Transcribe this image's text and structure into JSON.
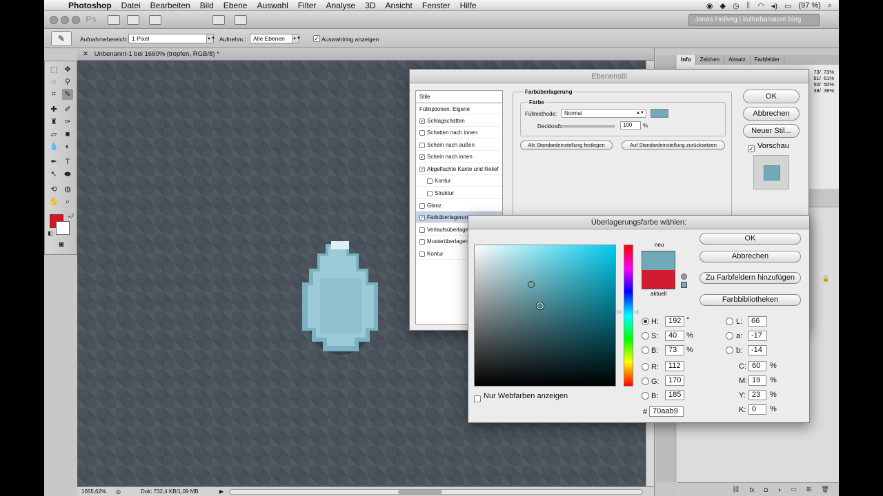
{
  "menubar": {
    "items": [
      "Photoshop",
      "Datei",
      "Bearbeiten",
      "Bild",
      "Ebene",
      "Auswahl",
      "Filter",
      "Analyse",
      "3D",
      "Ansicht",
      "Fenster",
      "Hilfe"
    ],
    "battery": "(97 %)"
  },
  "appbar": {
    "ps_badge": "Ps",
    "workspace_label": "Jonas Hellwig | kulturbanause blog"
  },
  "options": {
    "sample_size_label": "Aufnahmebereich:",
    "sample_size_value": "1 Pixel",
    "sample_label": "Aufnehm.:",
    "sample_value": "Alle Ebenen",
    "ring_label": "Auswahlring anzeigen"
  },
  "document": {
    "tab_title": "Unbenannt-1 bei 1660% (tropfen, RGB/8) *",
    "zoom": "1655,62%",
    "doc_info": "Dok: 732,4 KB/1,09 MB"
  },
  "right_panel": {
    "tabs": [
      "Info",
      "Zeichen",
      "Absatz",
      "Farbfelder"
    ],
    "info_values": "73/  73%\n61/  61%\n50/  50%\n38/  38%"
  },
  "ebenenstil": {
    "title": "Ebenenstil",
    "list": [
      {
        "label": "Stile",
        "checkbox": false
      },
      {
        "label": "Fülloptionen: Eigene",
        "checkbox": false
      },
      {
        "label": "Schlagschatten",
        "checkbox": true,
        "checked": true
      },
      {
        "label": "Schatten nach innen",
        "checkbox": true,
        "checked": false
      },
      {
        "label": "Schein nach außen",
        "checkbox": true,
        "checked": false
      },
      {
        "label": "Schein nach innen",
        "checkbox": true,
        "checked": true
      },
      {
        "label": "Abgeflachte Kante und Relief",
        "checkbox": true,
        "checked": true
      },
      {
        "label": "Kontur",
        "checkbox": true,
        "checked": false
      },
      {
        "label": "Struktur",
        "checkbox": true,
        "checked": false
      },
      {
        "label": "Glanz",
        "checkbox": true,
        "checked": false
      },
      {
        "label": "Farbüberlagerung",
        "checkbox": true,
        "checked": true
      },
      {
        "label": "Verlaufsüberlagerung",
        "checkbox": true,
        "checked": false
      },
      {
        "label": "Musterüberlagerung",
        "checkbox": true,
        "checked": false
      },
      {
        "label": "Kontur",
        "checkbox": true,
        "checked": false
      }
    ],
    "group_title": "Farbüberlagerung",
    "sub_title": "Farbe",
    "blend_label": "Füllmethode:",
    "blend_value": "Normal",
    "opacity_label": "Deckkraft:",
    "opacity_value": "100",
    "opacity_unit": "%",
    "overlay_color": "#70aab9",
    "btn_set_default": "Als Standardeinstellung festlegen",
    "btn_reset_default": "Auf Standardeinstellung zurücksetzen",
    "ok": "OK",
    "cancel": "Abbrechen",
    "new_style": "Neuer Stil...",
    "preview_label": "Vorschau"
  },
  "picker": {
    "title": "Überlagerungsfarbe wählen:",
    "new_label": "neu",
    "current_label": "aktuell",
    "new_color": "#70aab9",
    "current_color": "#d41a2e",
    "ok": "OK",
    "cancel": "Abbrechen",
    "add_swatches": "Zu Farbfeldern hinzufügen",
    "libraries": "Farbbibliotheken",
    "web_only": "Nur Webfarben anzeigen",
    "H": "192",
    "H_unit": "°",
    "S": "40",
    "S_unit": "%",
    "B": "73",
    "B_unit": "%",
    "R": "112",
    "G": "170",
    "Bl": "185",
    "L": "66",
    "a": "-17",
    "b": "-14",
    "C": "60",
    "M": "19",
    "Y": "23",
    "K": "0",
    "hex": "70aab9",
    "hue_color": "#00ccee"
  }
}
